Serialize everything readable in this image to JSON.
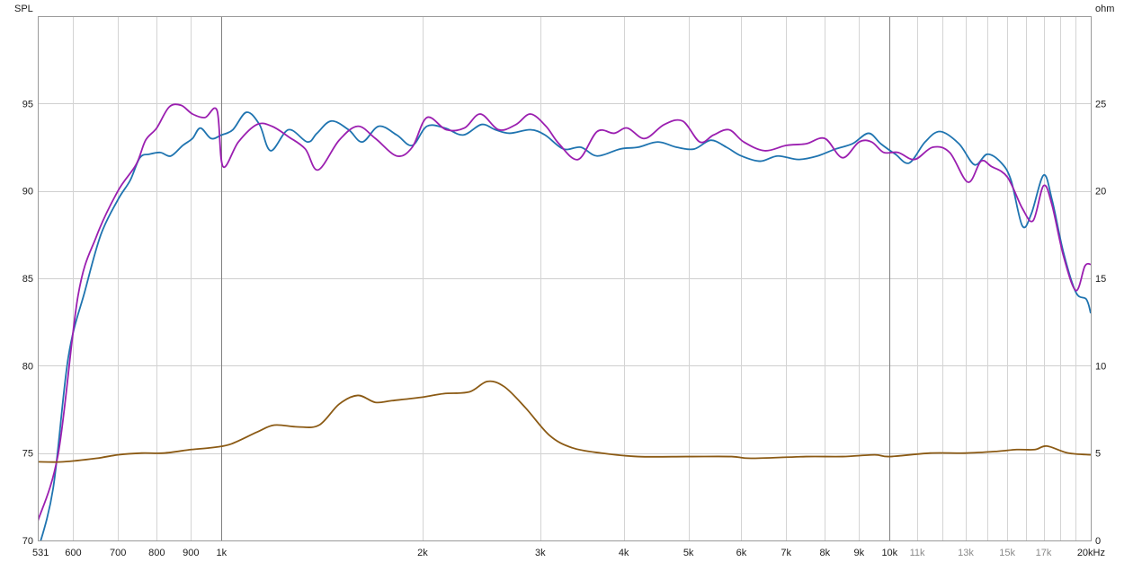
{
  "chart_data": {
    "type": "line",
    "x_scale": "log",
    "y_left_label": "SPL",
    "y_right_label": "ohm",
    "xlim": [
      531,
      20000
    ],
    "ylim_left": [
      70,
      100
    ],
    "ylim_right": [
      0,
      30
    ],
    "grid": true,
    "x_ticks": [
      {
        "value": 531,
        "label": "531",
        "muted": false
      },
      {
        "value": 600,
        "label": "600",
        "muted": false
      },
      {
        "value": 700,
        "label": "700",
        "muted": false
      },
      {
        "value": 800,
        "label": "800",
        "muted": false
      },
      {
        "value": 900,
        "label": "900",
        "muted": false
      },
      {
        "value": 1000,
        "label": "1k",
        "muted": false
      },
      {
        "value": 2000,
        "label": "2k",
        "muted": false
      },
      {
        "value": 3000,
        "label": "3k",
        "muted": false
      },
      {
        "value": 4000,
        "label": "4k",
        "muted": false
      },
      {
        "value": 5000,
        "label": "5k",
        "muted": false
      },
      {
        "value": 6000,
        "label": "6k",
        "muted": false
      },
      {
        "value": 7000,
        "label": "7k",
        "muted": false
      },
      {
        "value": 8000,
        "label": "8k",
        "muted": false
      },
      {
        "value": 9000,
        "label": "9k",
        "muted": false
      },
      {
        "value": 10000,
        "label": "10k",
        "muted": false
      },
      {
        "value": 11000,
        "label": "11k",
        "muted": true
      },
      {
        "value": 13000,
        "label": "13k",
        "muted": true
      },
      {
        "value": 15000,
        "label": "15k",
        "muted": true
      },
      {
        "value": 17000,
        "label": "17k",
        "muted": true
      },
      {
        "value": 20000,
        "label": "20kHz",
        "muted": false
      }
    ],
    "x_grid_extra": [
      12000,
      14000,
      16000,
      18000,
      19000
    ],
    "y_left_ticks": [
      {
        "value": 70,
        "label": "70"
      },
      {
        "value": 75,
        "label": "75"
      },
      {
        "value": 80,
        "label": "80"
      },
      {
        "value": 85,
        "label": "85"
      },
      {
        "value": 90,
        "label": "90"
      },
      {
        "value": 95,
        "label": "95"
      }
    ],
    "y_right_ticks": [
      {
        "value": 0,
        "label": "0"
      },
      {
        "value": 5,
        "label": "5"
      },
      {
        "value": 10,
        "label": "10"
      },
      {
        "value": 15,
        "label": "15"
      },
      {
        "value": 20,
        "label": "20"
      },
      {
        "value": 25,
        "label": "25"
      }
    ],
    "series": [
      {
        "color": "#1f74b0",
        "axis": "left",
        "points": [
          [
            531,
            69.4
          ],
          [
            560,
            73.0
          ],
          [
            590,
            80.5
          ],
          [
            625,
            84.3
          ],
          [
            660,
            87.5
          ],
          [
            700,
            89.5
          ],
          [
            730,
            90.6
          ],
          [
            755,
            91.9
          ],
          [
            780,
            92.1
          ],
          [
            810,
            92.2
          ],
          [
            840,
            92.0
          ],
          [
            875,
            92.6
          ],
          [
            905,
            93.0
          ],
          [
            930,
            93.6
          ],
          [
            965,
            93.0
          ],
          [
            1000,
            93.2
          ],
          [
            1040,
            93.5
          ],
          [
            1090,
            94.5
          ],
          [
            1140,
            93.8
          ],
          [
            1185,
            92.3
          ],
          [
            1260,
            93.5
          ],
          [
            1345,
            92.8
          ],
          [
            1390,
            93.3
          ],
          [
            1460,
            94.0
          ],
          [
            1550,
            93.5
          ],
          [
            1625,
            92.8
          ],
          [
            1720,
            93.7
          ],
          [
            1830,
            93.2
          ],
          [
            1930,
            92.6
          ],
          [
            2030,
            93.7
          ],
          [
            2160,
            93.6
          ],
          [
            2300,
            93.2
          ],
          [
            2450,
            93.8
          ],
          [
            2570,
            93.5
          ],
          [
            2700,
            93.3
          ],
          [
            2900,
            93.5
          ],
          [
            3050,
            93.2
          ],
          [
            3250,
            92.4
          ],
          [
            3450,
            92.5
          ],
          [
            3650,
            92.0
          ],
          [
            3950,
            92.4
          ],
          [
            4200,
            92.5
          ],
          [
            4500,
            92.8
          ],
          [
            4800,
            92.5
          ],
          [
            5100,
            92.4
          ],
          [
            5400,
            92.9
          ],
          [
            5700,
            92.5
          ],
          [
            6000,
            92.0
          ],
          [
            6400,
            91.7
          ],
          [
            6800,
            92.0
          ],
          [
            7300,
            91.8
          ],
          [
            7800,
            92.0
          ],
          [
            8300,
            92.4
          ],
          [
            8800,
            92.7
          ],
          [
            9300,
            93.3
          ],
          [
            9700,
            92.7
          ],
          [
            10200,
            92.1
          ],
          [
            10700,
            91.6
          ],
          [
            11300,
            92.8
          ],
          [
            11900,
            93.4
          ],
          [
            12700,
            92.7
          ],
          [
            13400,
            91.5
          ],
          [
            14000,
            92.1
          ],
          [
            14700,
            91.6
          ],
          [
            15200,
            90.6
          ],
          [
            15800,
            88.0
          ],
          [
            16300,
            88.7
          ],
          [
            17000,
            90.9
          ],
          [
            17500,
            89.5
          ],
          [
            18200,
            86.5
          ],
          [
            19000,
            84.2
          ],
          [
            19700,
            83.8
          ],
          [
            20000,
            83.0
          ]
        ]
      },
      {
        "color": "#9b1fb0",
        "axis": "left",
        "points": [
          [
            531,
            71.1
          ],
          [
            570,
            75.0
          ],
          [
            610,
            84.0
          ],
          [
            650,
            87.4
          ],
          [
            700,
            90.0
          ],
          [
            745,
            91.5
          ],
          [
            770,
            92.9
          ],
          [
            800,
            93.6
          ],
          [
            835,
            94.8
          ],
          [
            870,
            94.9
          ],
          [
            905,
            94.4
          ],
          [
            945,
            94.2
          ],
          [
            985,
            94.6
          ],
          [
            1005,
            91.4
          ],
          [
            1060,
            92.8
          ],
          [
            1130,
            93.8
          ],
          [
            1190,
            93.7
          ],
          [
            1260,
            93.1
          ],
          [
            1335,
            92.4
          ],
          [
            1395,
            91.2
          ],
          [
            1500,
            92.9
          ],
          [
            1600,
            93.7
          ],
          [
            1700,
            93.0
          ],
          [
            1830,
            92.0
          ],
          [
            1930,
            92.5
          ],
          [
            2030,
            94.2
          ],
          [
            2170,
            93.5
          ],
          [
            2310,
            93.6
          ],
          [
            2440,
            94.4
          ],
          [
            2600,
            93.5
          ],
          [
            2760,
            93.8
          ],
          [
            2900,
            94.4
          ],
          [
            3060,
            93.7
          ],
          [
            3200,
            92.7
          ],
          [
            3420,
            91.8
          ],
          [
            3650,
            93.4
          ],
          [
            3870,
            93.3
          ],
          [
            4050,
            93.6
          ],
          [
            4300,
            93.0
          ],
          [
            4600,
            93.8
          ],
          [
            4900,
            94.0
          ],
          [
            5200,
            92.8
          ],
          [
            5450,
            93.2
          ],
          [
            5750,
            93.5
          ],
          [
            6050,
            92.8
          ],
          [
            6500,
            92.3
          ],
          [
            7000,
            92.6
          ],
          [
            7500,
            92.7
          ],
          [
            8000,
            93.0
          ],
          [
            8500,
            91.9
          ],
          [
            9000,
            92.8
          ],
          [
            9400,
            92.8
          ],
          [
            9800,
            92.2
          ],
          [
            10300,
            92.2
          ],
          [
            10900,
            91.8
          ],
          [
            11600,
            92.5
          ],
          [
            12300,
            92.2
          ],
          [
            13100,
            90.5
          ],
          [
            13700,
            91.7
          ],
          [
            14200,
            91.4
          ],
          [
            15000,
            90.8
          ],
          [
            15800,
            89.0
          ],
          [
            16400,
            88.3
          ],
          [
            17000,
            90.3
          ],
          [
            17500,
            89.2
          ],
          [
            18200,
            86.3
          ],
          [
            19000,
            84.3
          ],
          [
            19600,
            85.7
          ],
          [
            20000,
            85.8
          ]
        ]
      },
      {
        "color": "#8b5a14",
        "axis": "right",
        "points": [
          [
            531,
            4.5
          ],
          [
            580,
            4.5
          ],
          [
            650,
            4.7
          ],
          [
            700,
            4.9
          ],
          [
            760,
            5.0
          ],
          [
            820,
            5.0
          ],
          [
            900,
            5.2
          ],
          [
            960,
            5.3
          ],
          [
            1030,
            5.5
          ],
          [
            1130,
            6.2
          ],
          [
            1200,
            6.6
          ],
          [
            1300,
            6.5
          ],
          [
            1400,
            6.6
          ],
          [
            1500,
            7.8
          ],
          [
            1600,
            8.3
          ],
          [
            1700,
            7.9
          ],
          [
            1800,
            8.0
          ],
          [
            2000,
            8.2
          ],
          [
            2150,
            8.4
          ],
          [
            2350,
            8.5
          ],
          [
            2500,
            9.1
          ],
          [
            2650,
            8.8
          ],
          [
            2850,
            7.6
          ],
          [
            3100,
            6.0
          ],
          [
            3350,
            5.3
          ],
          [
            3700,
            5.0
          ],
          [
            4200,
            4.8
          ],
          [
            5000,
            4.8
          ],
          [
            5800,
            4.8
          ],
          [
            6200,
            4.7
          ],
          [
            7500,
            4.8
          ],
          [
            8500,
            4.8
          ],
          [
            9500,
            4.9
          ],
          [
            10000,
            4.8
          ],
          [
            11500,
            5.0
          ],
          [
            13000,
            5.0
          ],
          [
            14500,
            5.1
          ],
          [
            15500,
            5.2
          ],
          [
            16500,
            5.2
          ],
          [
            17200,
            5.4
          ],
          [
            18500,
            5.0
          ],
          [
            20000,
            4.9
          ]
        ]
      }
    ]
  }
}
